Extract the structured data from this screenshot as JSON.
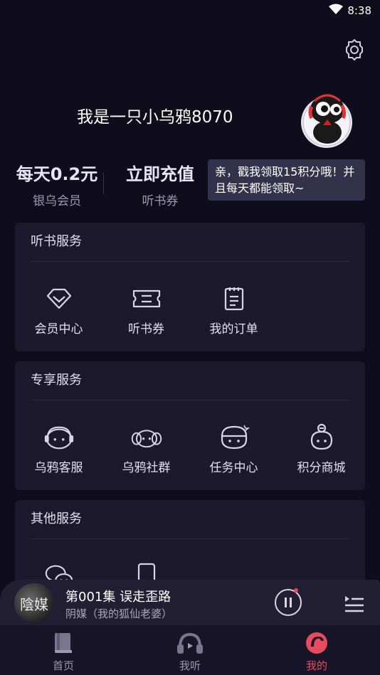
{
  "status": {
    "time": "8:38"
  },
  "profile": {
    "username": "我是一只小乌鸦8070",
    "vip_price": "每天0.2元",
    "vip_label": "银乌会员",
    "recharge": "立即充值",
    "recharge_label": "听书券",
    "tooltip": "亲，戳我领取15积分哦！并且每天都能领取~"
  },
  "sections": [
    {
      "title": "听书服务",
      "items": [
        {
          "label": "会员中心",
          "icon": "vip-diamond-icon"
        },
        {
          "label": "听书券",
          "icon": "ticket-icon"
        },
        {
          "label": "我的订单",
          "icon": "order-icon"
        }
      ]
    },
    {
      "title": "专享服务",
      "items": [
        {
          "label": "乌鸦客服",
          "icon": "customer-service-icon"
        },
        {
          "label": "乌鸦社群",
          "icon": "community-icon"
        },
        {
          "label": "任务中心",
          "icon": "task-icon"
        },
        {
          "label": "积分商城",
          "icon": "points-mall-icon"
        }
      ]
    },
    {
      "title": "其他服务",
      "items": [
        {
          "label": "",
          "icon": "wechat-icon"
        },
        {
          "label": "",
          "icon": "phone-icon"
        }
      ]
    }
  ],
  "player": {
    "cover_text": "陰媒",
    "title": "第001集 误走歪路",
    "subtitle": "阴媒（我的狐仙老婆）"
  },
  "tabs": [
    {
      "label": "首页",
      "icon": "book-icon"
    },
    {
      "label": "我听",
      "icon": "headphones-icon"
    },
    {
      "label": "我的",
      "icon": "crow-icon",
      "active": true
    }
  ],
  "colors": {
    "accent": "#e84a5f",
    "background": "#0f0c1c",
    "card": "#1c192d"
  }
}
